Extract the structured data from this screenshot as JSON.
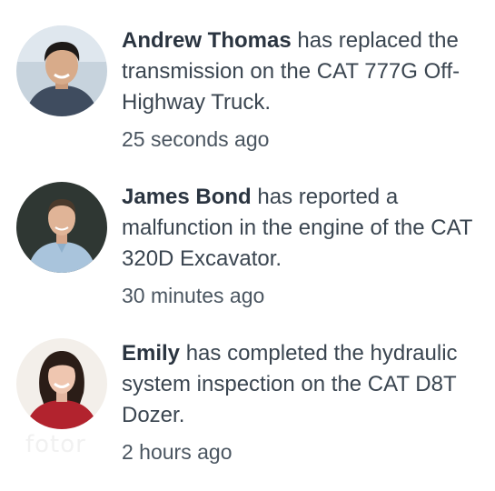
{
  "activity": [
    {
      "name": "Andrew Thomas",
      "message": "has replaced the transmission on the CAT 777G Off-Highway Truck.",
      "time": "25 seconds ago"
    },
    {
      "name": "James Bond",
      "message": "has reported a malfunction in the engine of the CAT 320D Excavator.",
      "time": "30 minutes ago"
    },
    {
      "name": "Emily",
      "message": "has completed the hydraulic system inspection on the CAT D8T Dozer.",
      "time": "2 hours ago"
    }
  ],
  "watermark": "fotor"
}
